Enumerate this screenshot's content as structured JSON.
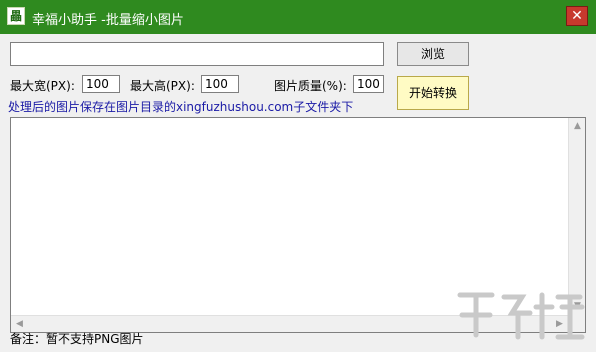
{
  "app": {
    "icon_glyph": "畾",
    "title": "幸福小助手 -批量缩小图片",
    "close_glyph": "✕"
  },
  "controls": {
    "path_value": "",
    "browse_label": "浏览",
    "max_width_label": "最大宽(PX):",
    "max_width_value": "100",
    "max_height_label": "最大高(PX):",
    "max_height_value": "100",
    "quality_label": "图片质量(%):",
    "quality_value": "100",
    "start_label": "开始转换",
    "save_note": "处理后的图片保存在图片目录的xingfuzhushou.com子文件夹下"
  },
  "log": {
    "text": ""
  },
  "footer": {
    "note": "备注：暂不支持PNG图片"
  },
  "icons": {
    "up": "▲",
    "down": "▼",
    "left": "◀",
    "right": "▶"
  },
  "colors": {
    "titlebar": "#2f8a1f",
    "close": "#c7392d",
    "note_text": "#1a1aa6",
    "start_button": "#fffbc4"
  }
}
